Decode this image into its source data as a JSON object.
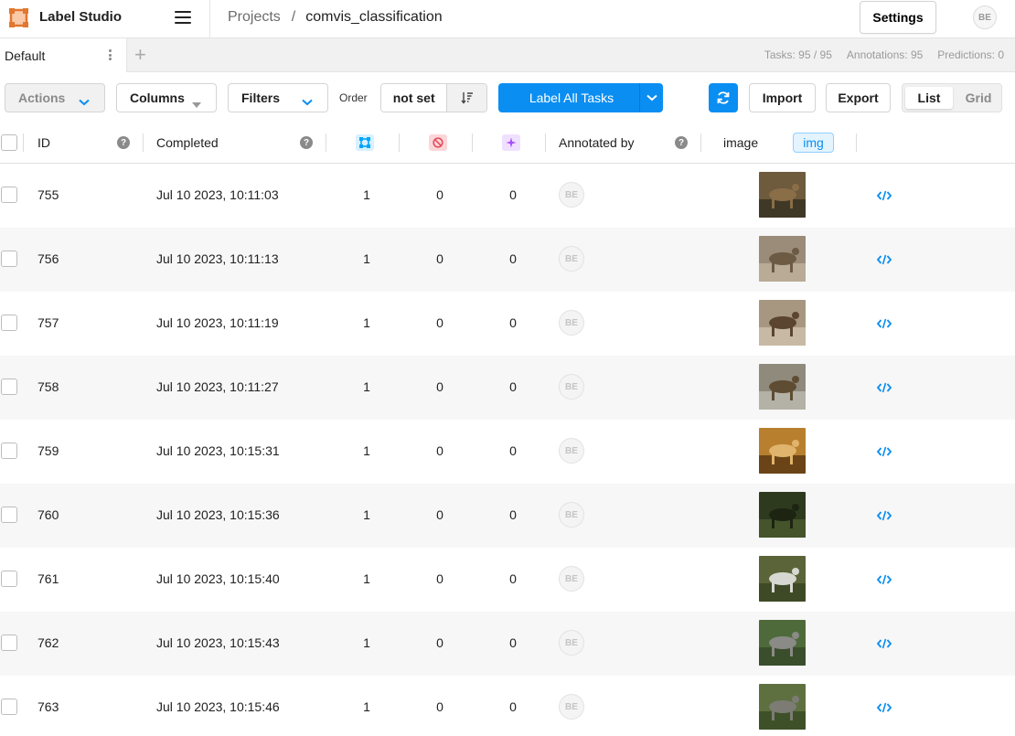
{
  "app": {
    "title": "Label Studio",
    "avatar_initials": "BE"
  },
  "breadcrumb": {
    "projects": "Projects",
    "separator": "/",
    "current": "comvis_classification"
  },
  "header": {
    "settings_label": "Settings"
  },
  "tabs": [
    {
      "label": "Default"
    }
  ],
  "stats": {
    "tasks": "Tasks: 95 / 95",
    "annotations": "Annotations: 95",
    "predictions": "Predictions: 0"
  },
  "toolbar": {
    "actions_label": "Actions",
    "columns_label": "Columns",
    "filters_label": "Filters",
    "order_label": "Order",
    "order_value": "not set",
    "label_all_label": "Label All Tasks",
    "import_label": "Import",
    "export_label": "Export",
    "view_list_label": "List",
    "view_grid_label": "Grid"
  },
  "colors": {
    "accent": "#0a8ef2",
    "completed_icon": "#00a6ff",
    "cancelled_icon": "#e44d5c",
    "predictions_icon": "#a64dff"
  },
  "columns": {
    "id": "ID",
    "completed": "Completed",
    "annotated_by": "Annotated by",
    "image": "image",
    "image_type": "img"
  },
  "rows": [
    {
      "id": "755",
      "completed": "Jul 10 2023, 10:11:03",
      "annotations": "1",
      "cancelled": "0",
      "predictions": "0",
      "annotator": "BE",
      "thumb_palette": [
        "#6e5a3c",
        "#8a6e48",
        "#3f3826",
        "#000000"
      ]
    },
    {
      "id": "756",
      "completed": "Jul 10 2023, 10:11:13",
      "annotations": "1",
      "cancelled": "0",
      "predictions": "0",
      "annotator": "BE",
      "thumb_palette": [
        "#9a8c78",
        "#6d5a44",
        "#b9ab96",
        "#000000"
      ]
    },
    {
      "id": "757",
      "completed": "Jul 10 2023, 10:11:19",
      "annotations": "1",
      "cancelled": "0",
      "predictions": "0",
      "annotator": "BE",
      "thumb_palette": [
        "#a79680",
        "#5b4531",
        "#c8b9a4",
        "#000000"
      ]
    },
    {
      "id": "758",
      "completed": "Jul 10 2023, 10:11:27",
      "annotations": "1",
      "cancelled": "0",
      "predictions": "0",
      "annotator": "BE",
      "thumb_palette": [
        "#8f8a7c",
        "#5e4c33",
        "#b4b1a6",
        "#6a6a5e"
      ]
    },
    {
      "id": "759",
      "completed": "Jul 10 2023, 10:15:31",
      "annotations": "1",
      "cancelled": "0",
      "predictions": "0",
      "annotator": "BE",
      "thumb_palette": [
        "#b8802e",
        "#e0b46c",
        "#6a4416",
        "#d99a45"
      ]
    },
    {
      "id": "760",
      "completed": "Jul 10 2023, 10:15:36",
      "annotations": "1",
      "cancelled": "0",
      "predictions": "0",
      "annotator": "BE",
      "thumb_palette": [
        "#2e3a1e",
        "#1d2412",
        "#45542b",
        "#2a2a20"
      ]
    },
    {
      "id": "761",
      "completed": "Jul 10 2023, 10:15:40",
      "annotations": "1",
      "cancelled": "0",
      "predictions": "0",
      "annotator": "BE",
      "thumb_palette": [
        "#5a6438",
        "#d8d8d2",
        "#3e4a26",
        "#7a6a44"
      ]
    },
    {
      "id": "762",
      "completed": "Jul 10 2023, 10:15:43",
      "annotations": "1",
      "cancelled": "0",
      "predictions": "0",
      "annotator": "BE",
      "thumb_palette": [
        "#4e6a3a",
        "#8a8a86",
        "#3a4e2c",
        "#b05050"
      ]
    },
    {
      "id": "763",
      "completed": "Jul 10 2023, 10:15:46",
      "annotations": "1",
      "cancelled": "0",
      "predictions": "0",
      "annotator": "BE",
      "thumb_palette": [
        "#5e7040",
        "#7c7c74",
        "#3e5028",
        "#4a5a34"
      ]
    }
  ]
}
